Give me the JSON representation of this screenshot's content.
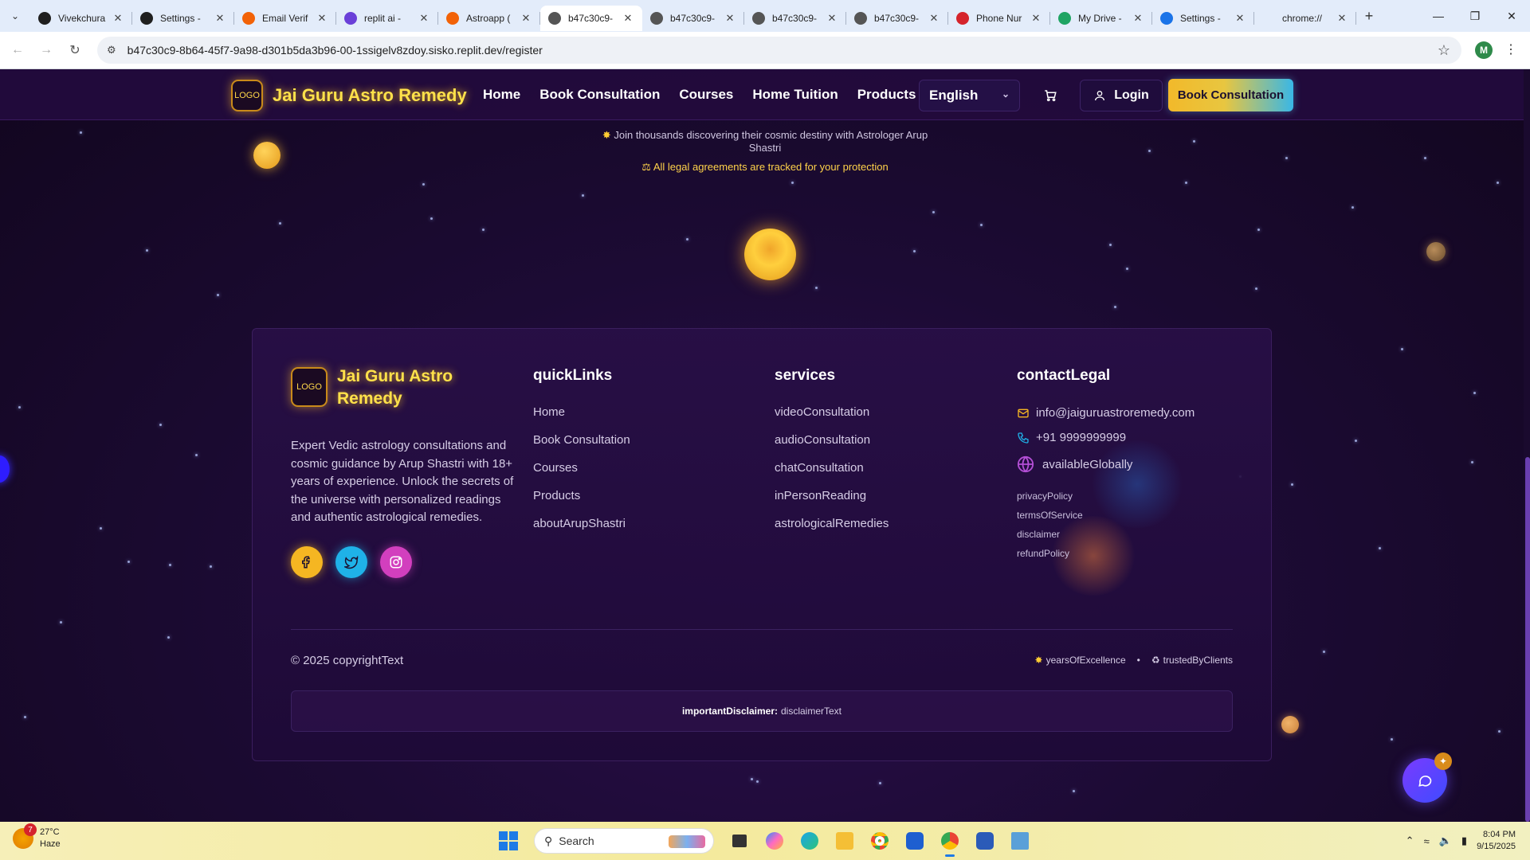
{
  "browser": {
    "tabs": [
      {
        "title": "Vivekchura",
        "favicon": "github-icon",
        "color": "#1f1f1f",
        "active": false
      },
      {
        "title": "Settings -",
        "favicon": "github-icon",
        "color": "#1f1f1f",
        "active": false
      },
      {
        "title": "Email Verif",
        "favicon": "replit-icon",
        "color": "#f26207",
        "active": false
      },
      {
        "title": "replit ai -",
        "favicon": "perplexity-icon",
        "color": "#6a3fd8",
        "active": false
      },
      {
        "title": "Astroapp (",
        "favicon": "replit-icon",
        "color": "#f26207",
        "active": false
      },
      {
        "title": "b47c30c9-",
        "favicon": "globe-icon",
        "color": "#555555",
        "active": true
      },
      {
        "title": "b47c30c9-",
        "favicon": "globe-icon",
        "color": "#555555",
        "active": false
      },
      {
        "title": "b47c30c9-",
        "favicon": "globe-icon",
        "color": "#555555",
        "active": false
      },
      {
        "title": "b47c30c9-",
        "favicon": "globe-icon",
        "color": "#555555",
        "active": false
      },
      {
        "title": "Phone Nur",
        "favicon": "phone-app-icon",
        "color": "#d5232b",
        "active": false
      },
      {
        "title": "My Drive -",
        "favicon": "google-drive-icon",
        "color": "#1fa463",
        "active": false
      },
      {
        "title": "Settings -",
        "favicon": "settings-gear-icon",
        "color": "#1a73e8",
        "active": false
      },
      {
        "title": "chrome://",
        "favicon": "",
        "color": "#555555",
        "active": false
      }
    ],
    "url": "b47c30c9-8b64-45f7-9a98-d301b5da3b96-00-1ssigelv8zdoy.sisko.replit.dev/register",
    "profile_initial": "M"
  },
  "site": {
    "logo_text": "LOGO",
    "brand": "Jai Guru Astro Remedy",
    "nav": [
      "Home",
      "Book Consultation",
      "Courses",
      "Home Tuition",
      "Products"
    ],
    "language": "English",
    "login": "Login",
    "cta": "Book Consultation",
    "note_line1": "Join thousands discovering their cosmic destiny with Astrologer Arup",
    "note_line2": "Shastri",
    "note_legal": "All legal agreements are tracked for your protection"
  },
  "footer": {
    "brand_line1": "Jai Guru Astro",
    "brand_line2": "Remedy",
    "description": "Expert Vedic astrology consultations and cosmic guidance by Arup Shastri with 18+ years of experience. Unlock the secrets of the universe with personalized readings and authentic astrological remedies.",
    "social": [
      "facebook-icon",
      "twitter-icon",
      "instagram-icon"
    ],
    "quick_links_title": "quickLinks",
    "quick_links": [
      "Home",
      "Book Consultation",
      "Courses",
      "Products",
      "aboutArupShastri"
    ],
    "services_title": "services",
    "services": [
      "videoConsultation",
      "audioConsultation",
      "chatConsultation",
      "inPersonReading",
      "astrologicalRemedies"
    ],
    "contact_title": "contactLegal",
    "email": "info@jaiguruastroremedy.com",
    "phone": "+91 9999999999",
    "availability": "availableGlobally",
    "legal": [
      "privacyPolicy",
      "termsOfService",
      "disclaimer",
      "refundPolicy"
    ],
    "copyright": "© 2025 copyrightText",
    "badge1": "yearsOfExcellence",
    "badge2": "trustedByClients",
    "disclaimer_label": "importantDisclaimer:",
    "disclaimer_text": "disclaimerText"
  },
  "taskbar": {
    "weather_temp": "27°C",
    "weather_desc": "Haze",
    "weather_badge": "7",
    "search_placeholder": "Search",
    "time": "8:04 PM",
    "date": "9/15/2025"
  }
}
